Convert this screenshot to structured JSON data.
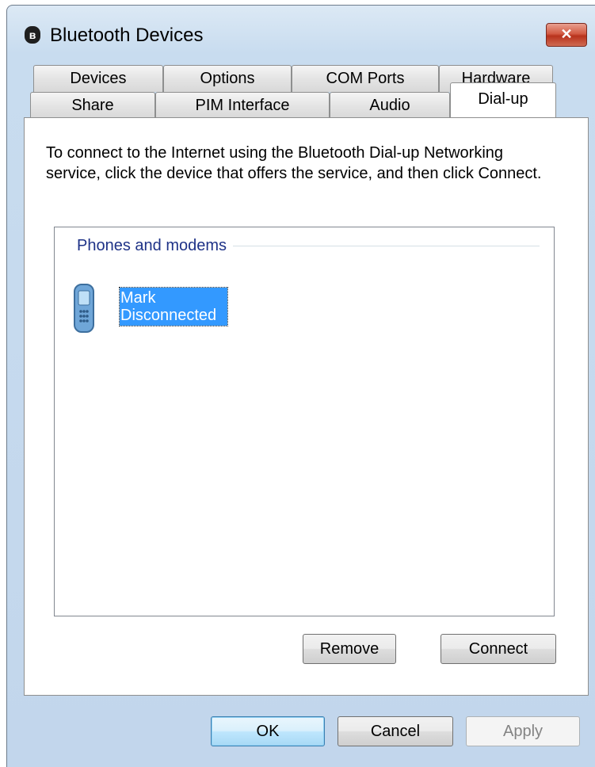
{
  "window": {
    "title": "Bluetooth Devices",
    "close_label": "✕"
  },
  "tabs": {
    "row1": [
      "Devices",
      "Options",
      "COM Ports",
      "Hardware"
    ],
    "row2": [
      "Share",
      "PIM Interface",
      "Audio",
      "Dial-up"
    ],
    "selected": "Dial-up"
  },
  "dialup": {
    "instructions": "To connect to the Internet using the Bluetooth Dial-up Networking service, click the device that offers the service, and then click Connect.",
    "group_header": "Phones and modems",
    "devices": [
      {
        "name": "Mark",
        "status": "Disconnected",
        "icon": "phone-icon"
      }
    ],
    "remove_label": "Remove",
    "connect_label": "Connect"
  },
  "footer": {
    "ok_label": "OK",
    "cancel_label": "Cancel",
    "apply_label": "Apply"
  },
  "colors": {
    "selection": "#3399ff",
    "group_header": "#1e3287",
    "close_button": "#c8432c"
  }
}
